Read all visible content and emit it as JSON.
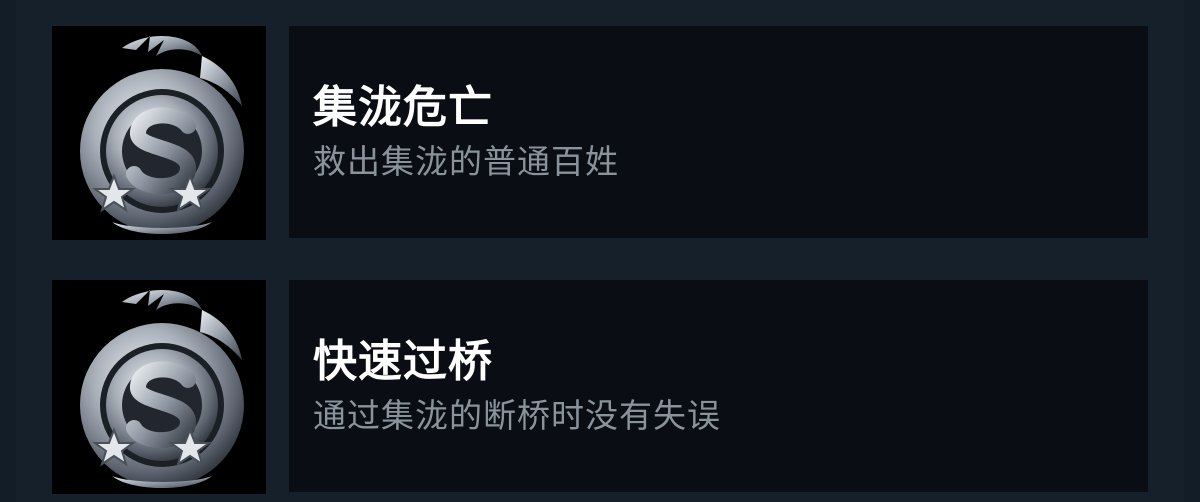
{
  "achievements": [
    {
      "icon": "silver-dragon-emblem-icon",
      "title": "集泷危亡",
      "description": "救出集泷的普通百姓"
    },
    {
      "icon": "silver-dragon-emblem-icon",
      "title": "快速过桥",
      "description": "通过集泷的断桥时没有失误"
    }
  ],
  "colors": {
    "background": "#131d28",
    "card": "#0a0d13",
    "title": "#ffffff",
    "description": "#8a939c"
  }
}
